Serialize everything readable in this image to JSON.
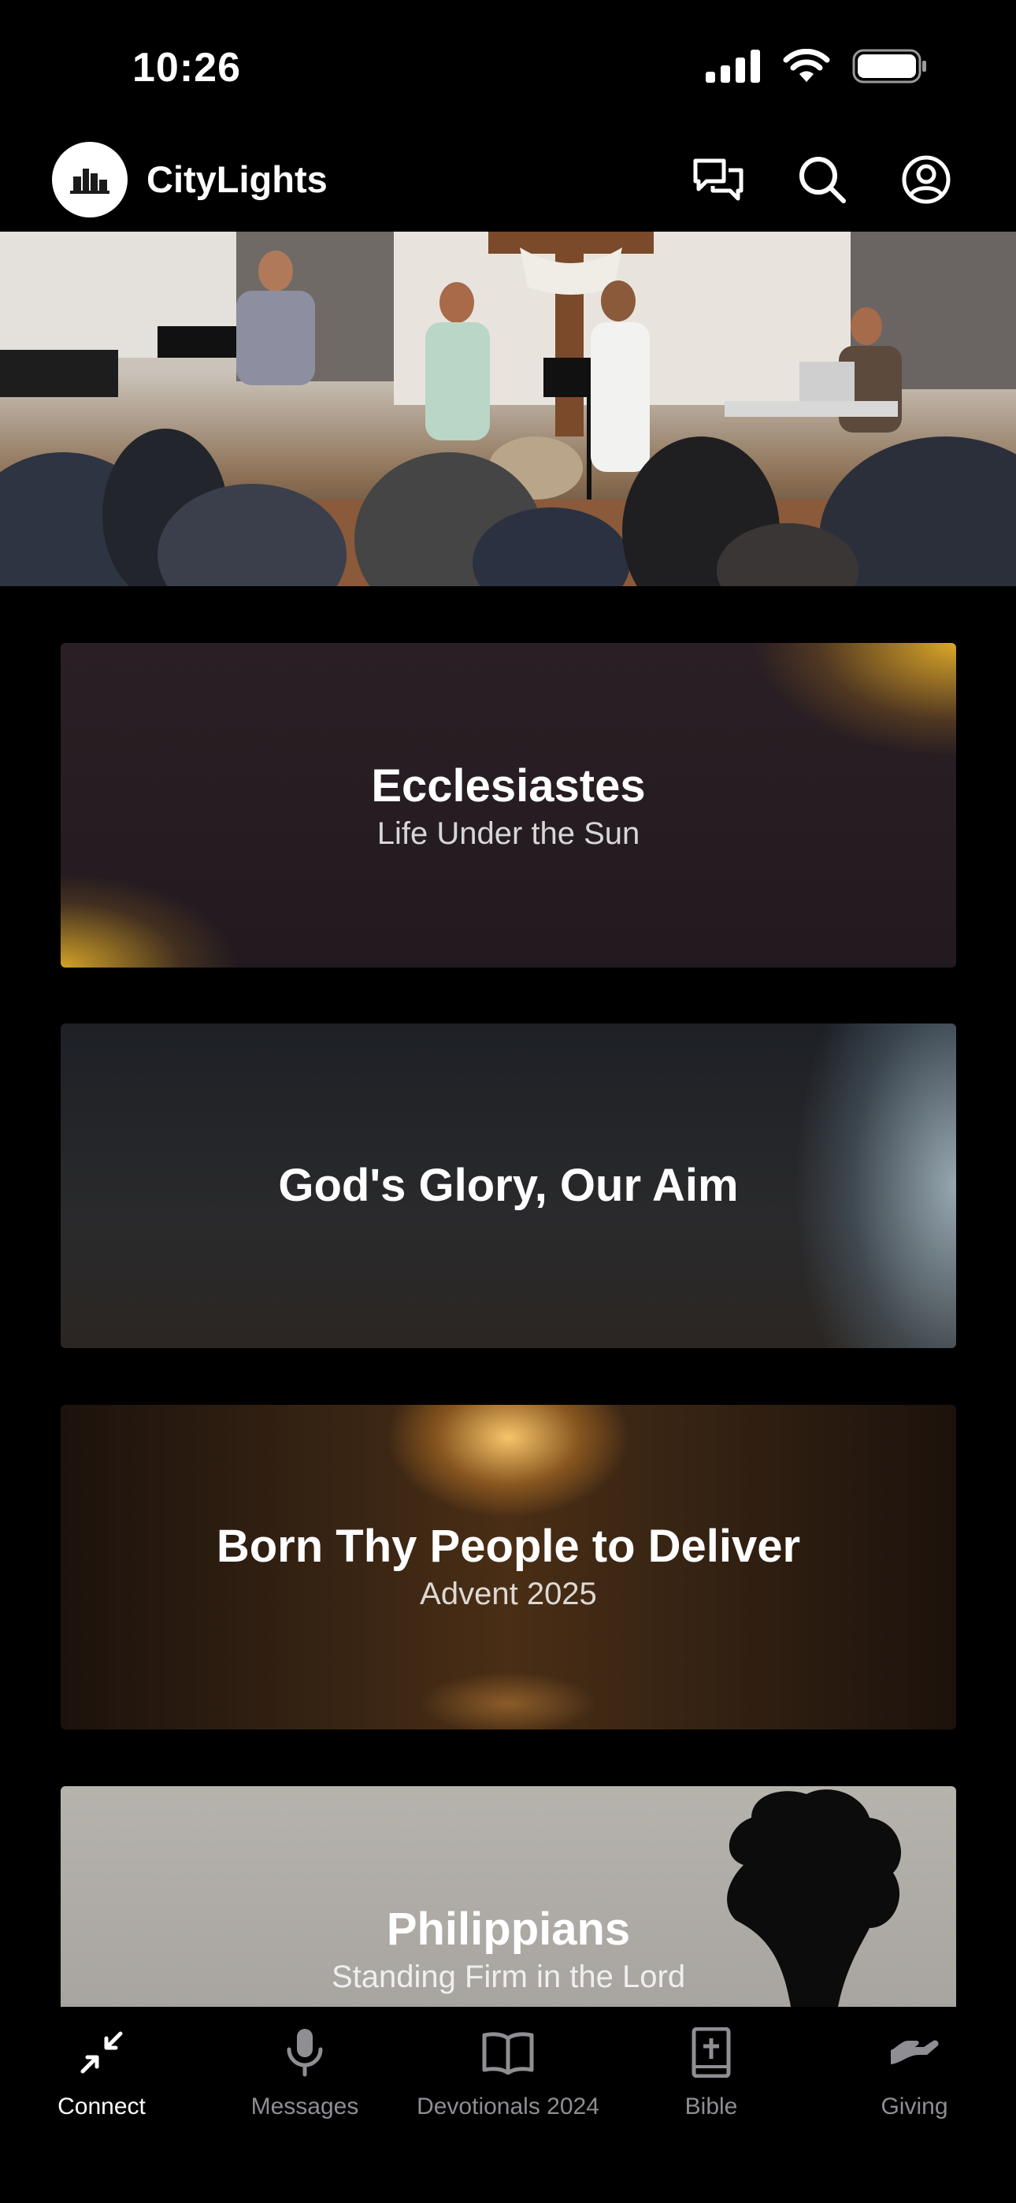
{
  "status_bar": {
    "time": "10:26",
    "icons": [
      "signal-icon",
      "wifi-icon",
      "battery-icon"
    ]
  },
  "header": {
    "app_name": "CityLights",
    "icons": [
      "chat-icon",
      "search-icon",
      "profile-icon"
    ]
  },
  "cards": [
    {
      "title": "Ecclesiastes",
      "subtitle": "Life Under the Sun"
    },
    {
      "title": "God's Glory, Our Aim",
      "subtitle": ""
    },
    {
      "title": "Born Thy People to Deliver",
      "subtitle": "Advent 2025"
    },
    {
      "title": "Philippians",
      "subtitle": "Standing Firm in the Lord"
    }
  ],
  "tabs": [
    {
      "label": "Connect",
      "icon": "connect-icon",
      "active": true
    },
    {
      "label": "Messages",
      "icon": "microphone-icon",
      "active": false
    },
    {
      "label": "Devotionals 2024",
      "icon": "open-book-icon",
      "active": false
    },
    {
      "label": "Bible",
      "icon": "bible-icon",
      "active": false
    },
    {
      "label": "Giving",
      "icon": "giving-hand-icon",
      "active": false
    }
  ],
  "colors": {
    "background": "#000000",
    "active_tab": "#ffffff",
    "inactive_tab": "#8e8e93"
  }
}
